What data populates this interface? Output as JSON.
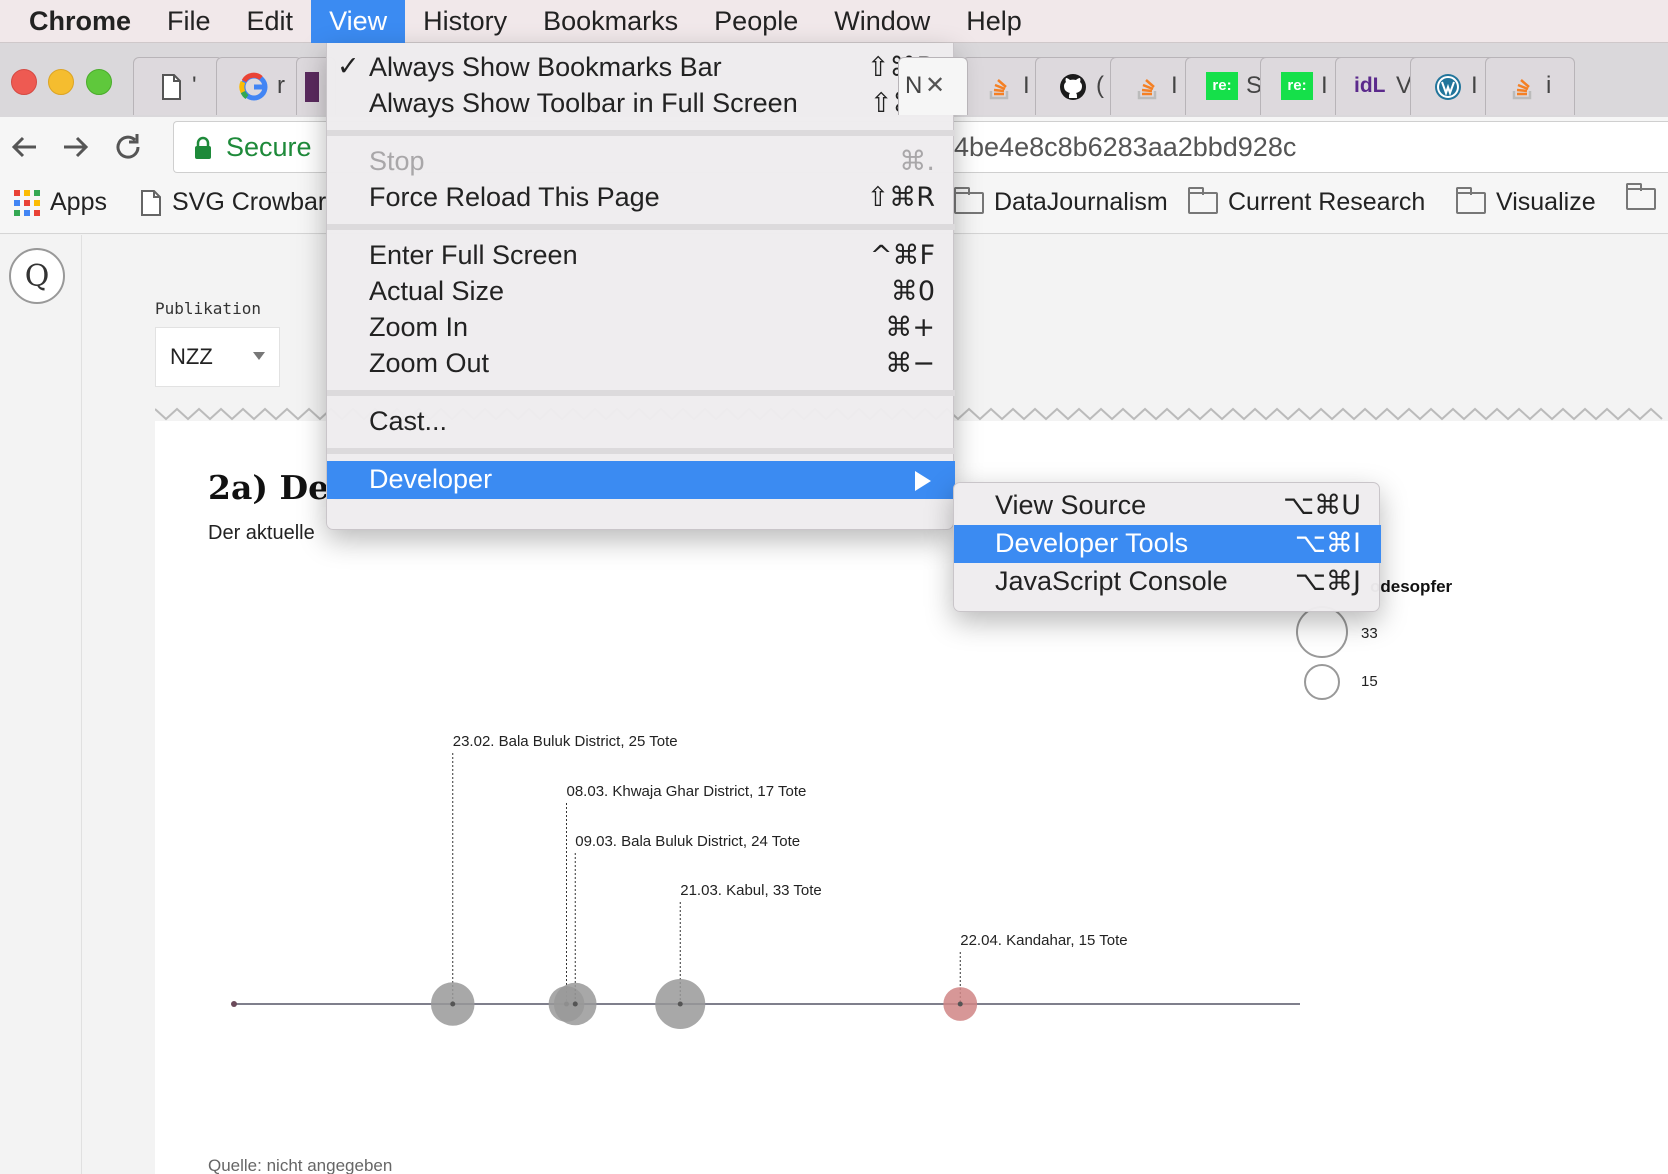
{
  "menubar": {
    "app": "Chrome",
    "items": [
      "File",
      "Edit",
      "View",
      "History",
      "Bookmarks",
      "People",
      "Window",
      "Help"
    ],
    "active": "View"
  },
  "tabs": {
    "fragments": [
      "'",
      "r",
      "",
      "N",
      "I",
      "(",
      "I",
      "S",
      "I",
      "V",
      "I",
      "i"
    ],
    "badge_re": "re:",
    "badge_idl": "idL"
  },
  "toolbar": {
    "secure_label": "Secure",
    "url_tail": "4be4e8c8b6283aa2bbd928c"
  },
  "bookmarks": {
    "apps": "Apps",
    "svg_crowbar": "SVG Crowbar",
    "datajournalism": "DataJournalism",
    "current_research": "Current Research",
    "visualize": "Visualize"
  },
  "page": {
    "logo": "Q",
    "pub_label": "Publikation",
    "pub_value": "NZZ",
    "heading": "2a) Des",
    "lead": "Der aktuelle",
    "legend_title": "odesopfer",
    "legend_values": [
      "33",
      "15"
    ],
    "source": "Quelle: nicht angegeben"
  },
  "chart_data": {
    "type": "scatter",
    "title": "",
    "xlabel": "",
    "ylabel": "",
    "events": [
      {
        "date": "23.02.",
        "place": "Bala Buluk District",
        "deaths": 25,
        "label": "23.02. Bala Buluk District, 25 Tote",
        "highlight": false
      },
      {
        "date": "08.03.",
        "place": "Khwaja Ghar District",
        "deaths": 17,
        "label": "08.03. Khwaja Ghar District, 17 Tote",
        "highlight": false
      },
      {
        "date": "09.03.",
        "place": "Bala Buluk District",
        "deaths": 24,
        "label": "09.03. Bala Buluk District, 24 Tote",
        "highlight": false
      },
      {
        "date": "21.03.",
        "place": "Kabul",
        "deaths": 33,
        "label": "21.03. Kabul, 33 Tote",
        "highlight": false
      },
      {
        "date": "22.04.",
        "place": "Kandahar",
        "deaths": 15,
        "label": "22.04. Kandahar, 15 Tote",
        "highlight": true
      }
    ],
    "colors": {
      "point": "#999999",
      "highlight": "#d08585",
      "axis": "#555566"
    }
  },
  "view_menu": {
    "always_bookmarks": {
      "label": "Always Show Bookmarks Bar",
      "shortcut": "⇧⌘B",
      "checked": "✓"
    },
    "always_toolbar": {
      "label": "Always Show Toolbar in Full Screen",
      "shortcut": "⇧⌘F"
    },
    "stop": {
      "label": "Stop",
      "shortcut": "⌘."
    },
    "force_reload": {
      "label": "Force Reload This Page",
      "shortcut": "⇧⌘R"
    },
    "full_screen": {
      "label": "Enter Full Screen",
      "shortcut": "^⌘F"
    },
    "actual_size": {
      "label": "Actual Size",
      "shortcut": "⌘0"
    },
    "zoom_in": {
      "label": "Zoom In",
      "shortcut": "⌘+"
    },
    "zoom_out": {
      "label": "Zoom Out",
      "shortcut": "⌘−"
    },
    "cast": {
      "label": "Cast..."
    },
    "developer": {
      "label": "Developer"
    }
  },
  "developer_menu": {
    "view_source": {
      "label": "View Source",
      "shortcut": "⌥⌘U"
    },
    "dev_tools": {
      "label": "Developer Tools",
      "shortcut": "⌥⌘I"
    },
    "js_console": {
      "label": "JavaScript Console",
      "shortcut": "⌥⌘J"
    }
  },
  "colors": {
    "accent": "#3b8bf2",
    "secure": "#1e8a3a"
  }
}
